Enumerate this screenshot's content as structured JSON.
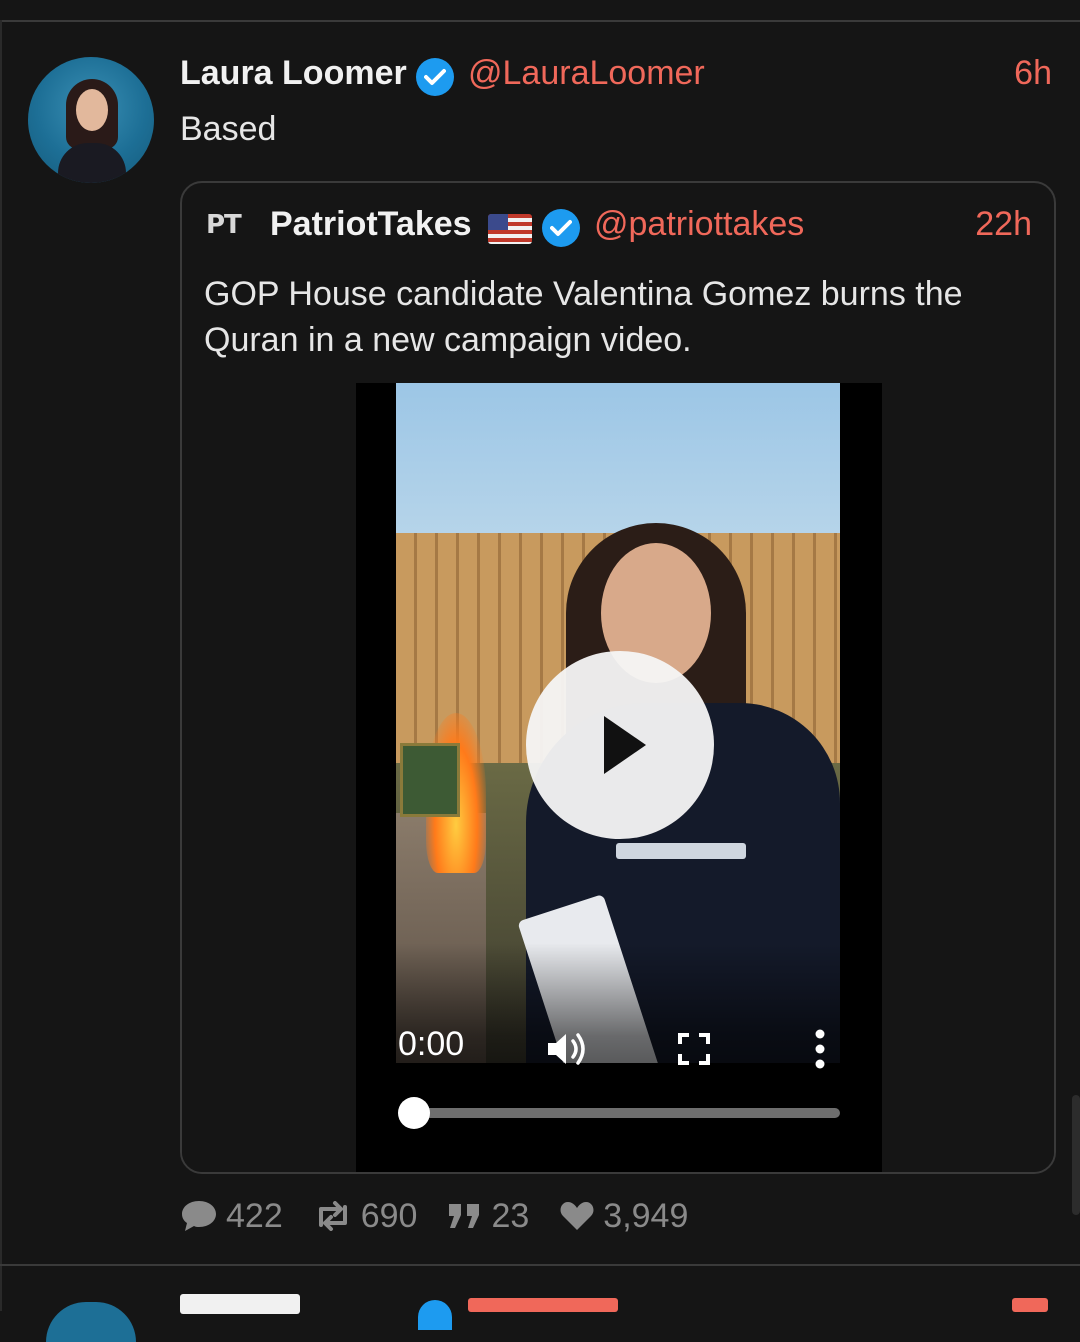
{
  "post": {
    "author_name": "Laura Loomer",
    "author_handle": "@LauraLoomer",
    "time": "6h",
    "text": "Based",
    "avatar_icon": "profile-photo"
  },
  "quote": {
    "logo_text": "PT",
    "author_name": "PatriotTakes",
    "flag_icon": "us-flag-icon",
    "author_handle": "@patriottakes",
    "time": "22h",
    "text": "GOP House candidate Valentina Gomez burns the Quran in a new campaign video."
  },
  "video": {
    "current_time": "0:00",
    "progress": 0,
    "icons": [
      "play-icon",
      "volume-icon",
      "fullscreen-icon",
      "more-vert-icon"
    ]
  },
  "actions": {
    "replies": "422",
    "reposts": "690",
    "quotes": "23",
    "likes": "3,949"
  },
  "colors": {
    "background": "#151515",
    "accent": "#f0685a",
    "verified": "#1d9bf0",
    "muted": "#8a8a8a"
  }
}
